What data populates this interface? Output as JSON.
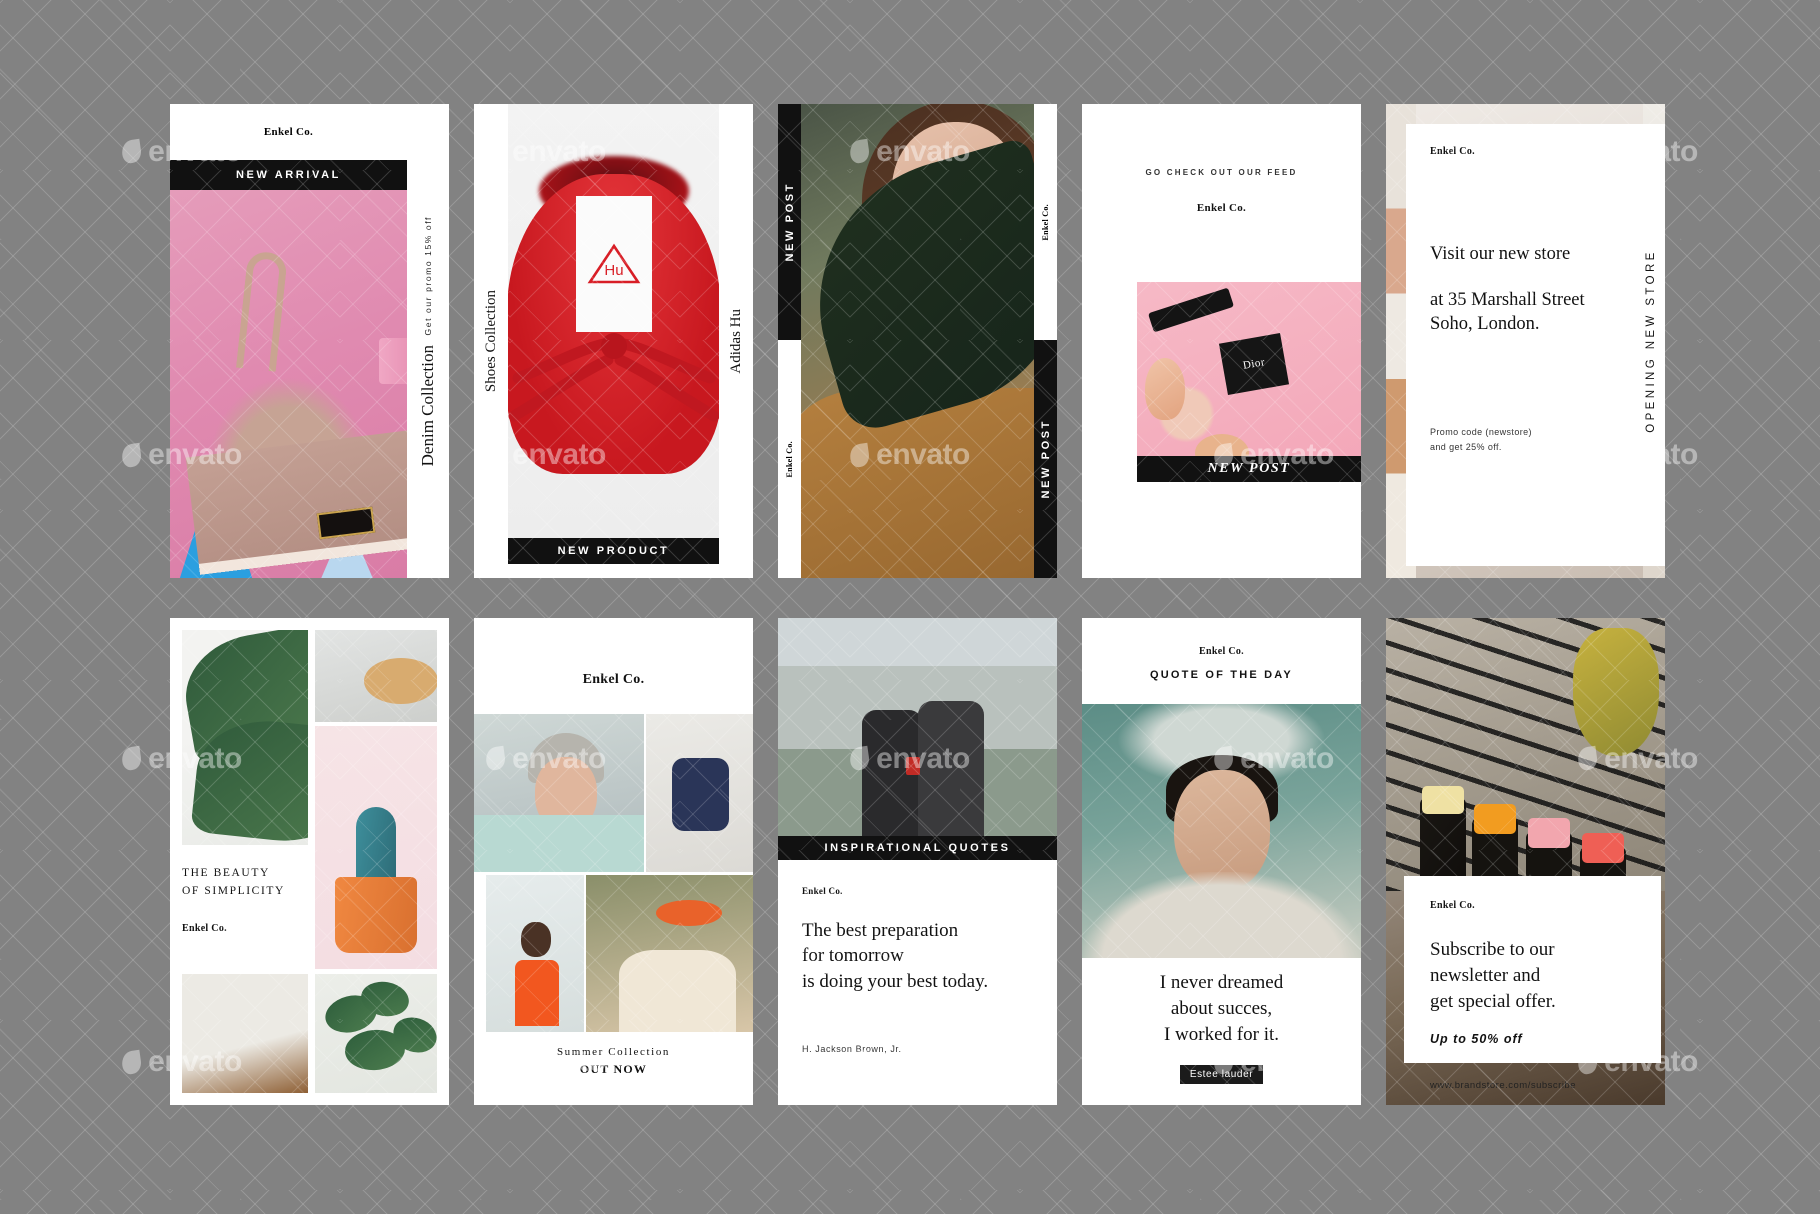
{
  "background": {
    "color": "#828282",
    "watermark_text": "envato"
  },
  "brand": "Enkel Co.",
  "cards": [
    {
      "id": "card-new-arrival",
      "brand": "Enkel Co.",
      "banner": "NEW ARRIVAL",
      "side_small": "Get our promo 15% off",
      "side_title": "Denim Collection"
    },
    {
      "id": "card-shoes",
      "left_vertical": "Shoes Collection",
      "right_vertical": "Adidas  Hu",
      "product_mark": "Hu",
      "banner": "NEW PRODUCT"
    },
    {
      "id": "card-new-post-leaf",
      "banner_top": "NEW POST",
      "banner_bottom": "NEW POST",
      "brand_top": "Enkel Co.",
      "brand_bottom": "Enkel Co."
    },
    {
      "id": "card-feed",
      "headline": "GO CHECK OUT OUR FEED",
      "brand": "Enkel Co.",
      "photo_brand": "Dior",
      "banner": "NEW POST"
    },
    {
      "id": "card-new-store",
      "brand": "Enkel Co.",
      "line1": "Visit our new store",
      "line2": "at 35 Marshall Street",
      "line3": "Soho, London.",
      "promo_line1": "Promo code (newstore)",
      "promo_line2": "and get 25% off.",
      "vertical": "OPENING NEW STORE"
    },
    {
      "id": "card-simplicity",
      "title_line1": "THE BEAUTY",
      "title_line2": "OF SIMPLICITY",
      "brand": "Enkel Co."
    },
    {
      "id": "card-summer",
      "brand": "Enkel Co.",
      "footer_line1": "Summer Collection",
      "footer_line2": "OUT NOW"
    },
    {
      "id": "card-inspirational",
      "banner": "INSPIRATIONAL QUOTES",
      "brand": "Enkel Co.",
      "quote_line1": "The best preparation",
      "quote_line2": "for tomorrow",
      "quote_line3": "is doing your best today.",
      "author": "H. Jackson Brown, Jr."
    },
    {
      "id": "card-quote-of-the-day",
      "brand": "Enkel Co.",
      "subtitle": "QUOTE OF THE DAY",
      "quote_line1": "I never dreamed",
      "quote_line2": "about succes,",
      "quote_line3": "I worked for it.",
      "author_badge": "Estee lauder"
    },
    {
      "id": "card-subscribe",
      "brand": "Enkel Co.",
      "line1": "Subscribe to our",
      "line2": "newsletter and",
      "line3": "get special offer.",
      "offer": "Up to 50% off",
      "url": "www.brandstore.com/subscribe"
    }
  ],
  "colors": {
    "black_banner": "#111111",
    "page_bg": "#828282",
    "card_bg": "#ffffff",
    "accent_red": "#cc1820",
    "accent_pink": "#e08ab0"
  }
}
